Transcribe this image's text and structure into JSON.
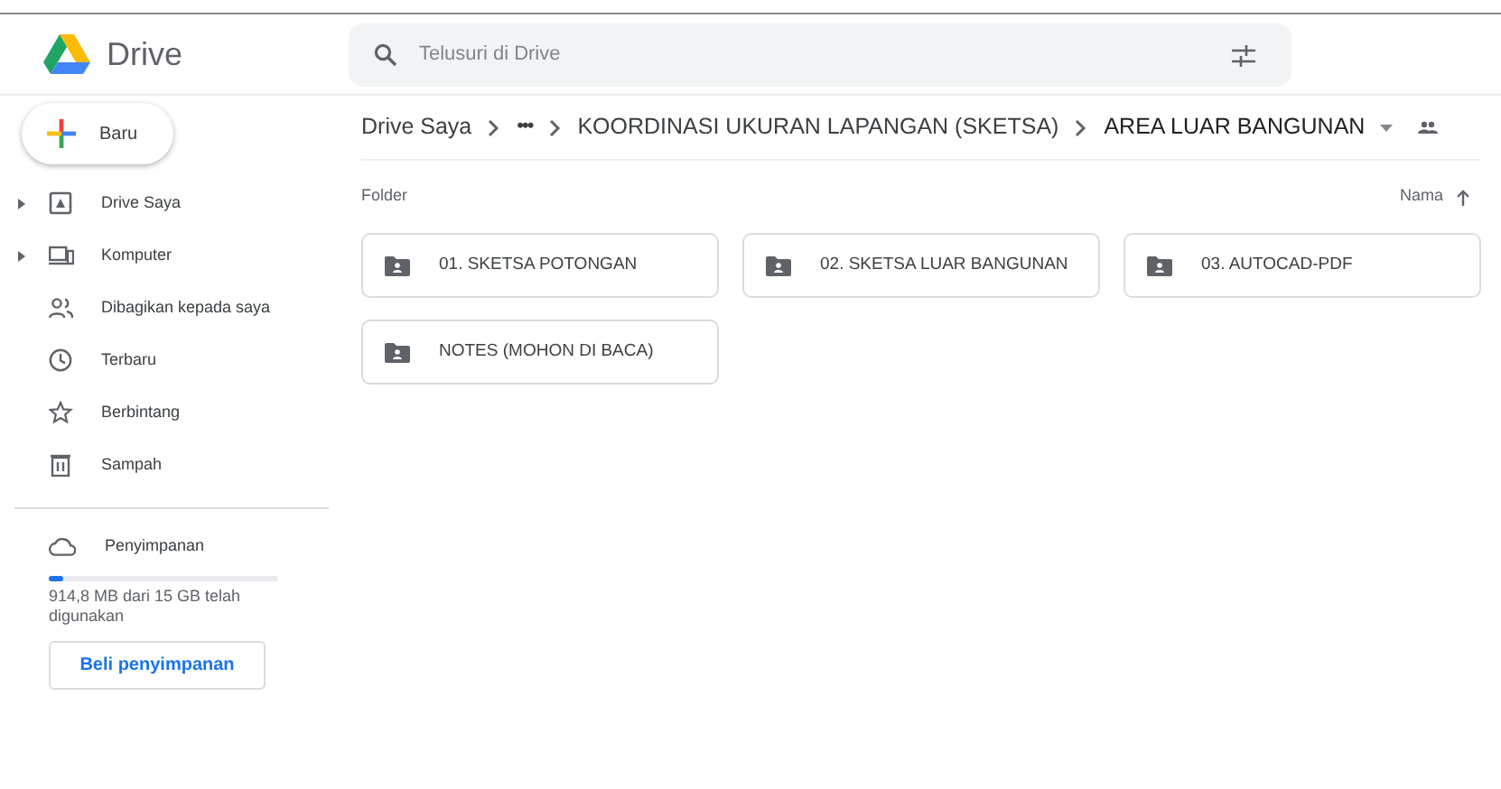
{
  "app": {
    "name": "Drive"
  },
  "search": {
    "placeholder": "Telusuri di Drive"
  },
  "new_button": {
    "label": "Baru"
  },
  "sidebar": {
    "items": [
      {
        "label": "Drive Saya",
        "kind": "drive",
        "expandable": true
      },
      {
        "label": "Komputer",
        "kind": "computer",
        "expandable": true
      },
      {
        "label": "Dibagikan kepada saya",
        "kind": "shared",
        "expandable": false
      },
      {
        "label": "Terbaru",
        "kind": "recent",
        "expandable": false
      },
      {
        "label": "Berbintang",
        "kind": "starred",
        "expandable": false
      },
      {
        "label": "Sampah",
        "kind": "trash",
        "expandable": false
      }
    ]
  },
  "storage": {
    "label": "Penyimpanan",
    "level": 0.06,
    "usage": "914,8 MB dari 15 GB telah digunakan",
    "button": "Beli penyimpanan"
  },
  "breadcrumb": {
    "items": [
      "Drive Saya",
      "•••",
      "KOORDINASI UKURAN LAPANGAN (SKETSA)",
      "AREA LUAR BANGUNAN"
    ]
  },
  "section": {
    "title": "Folder",
    "sort": "Nama"
  },
  "folders": [
    {
      "name": "01. SKETSA POTONGAN"
    },
    {
      "name": "02. SKETSA LUAR BANGUNAN"
    },
    {
      "name": "03. AUTOCAD-PDF"
    },
    {
      "name": "NOTES (MOHON DI BACA)"
    }
  ]
}
